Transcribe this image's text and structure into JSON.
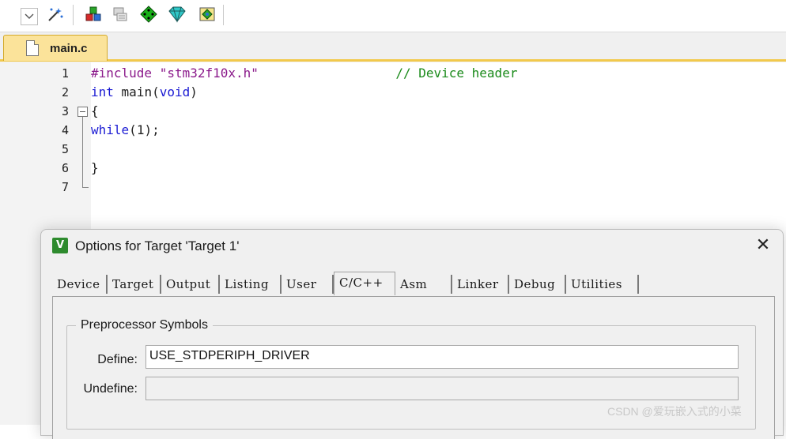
{
  "toolbar": {
    "icons": [
      "dropdown-arrow-icon",
      "target-wand-icon",
      "pack-installer-icon",
      "manage-project-items-icon",
      "select-packs-icon",
      "manage-runtime-icon",
      "pack-diamond-icon"
    ]
  },
  "editor": {
    "tab_label": "main.c",
    "lines": [
      {
        "no": "1",
        "parts": [
          {
            "t": "#include ",
            "c": "pp"
          },
          {
            "t": "\"stm32f10x.h\"",
            "c": "str"
          },
          {
            "t": "                  ",
            "c": "pn"
          },
          {
            "t": "// Device header",
            "c": "cm"
          }
        ]
      },
      {
        "no": "2",
        "parts": [
          {
            "t": "int",
            "c": "kw"
          },
          {
            "t": " main",
            "c": "pn"
          },
          {
            "t": "(",
            "c": "pn"
          },
          {
            "t": "void",
            "c": "kw"
          },
          {
            "t": ")",
            "c": "pn"
          }
        ]
      },
      {
        "no": "3",
        "parts": [
          {
            "t": "{",
            "c": "pn"
          }
        ]
      },
      {
        "no": "4",
        "parts": [
          {
            "t": "while",
            "c": "kw"
          },
          {
            "t": "(",
            "c": "pn"
          },
          {
            "t": "1",
            "c": "num"
          },
          {
            "t": ");",
            "c": "pn"
          }
        ]
      },
      {
        "no": "5",
        "parts": []
      },
      {
        "no": "6",
        "parts": [
          {
            "t": "}",
            "c": "pn"
          }
        ]
      },
      {
        "no": "7",
        "parts": []
      }
    ]
  },
  "dialog": {
    "icon_text": "V",
    "title": "Options for Target 'Target 1'",
    "close_glyph": "✕",
    "tabs": [
      "Device",
      "Target",
      "Output",
      "Listing",
      "User",
      "C/C++",
      "Asm",
      "Linker",
      "Debug",
      "Utilities"
    ],
    "active_tab": "C/C++",
    "preprocessor": {
      "group_label": "Preprocessor Symbols",
      "define_label": "Define:",
      "define_value": "USE_STDPERIPH_DRIVER",
      "undefine_label": "Undefine:",
      "undefine_value": ""
    }
  },
  "watermark": "CSDN @爱玩嵌入式的小菜"
}
